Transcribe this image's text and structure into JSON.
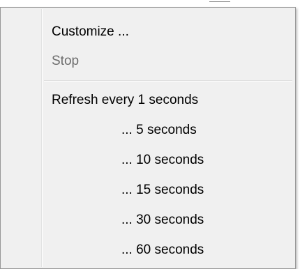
{
  "menu": {
    "items_top": [
      {
        "label": "Customize ...",
        "enabled": true
      },
      {
        "label": "Stop",
        "enabled": false
      }
    ],
    "refresh": {
      "first_label": "Refresh every 1 seconds",
      "options": [
        "... 5 seconds",
        "... 10 seconds",
        "... 15 seconds",
        "... 30 seconds",
        "... 60 seconds"
      ]
    }
  }
}
